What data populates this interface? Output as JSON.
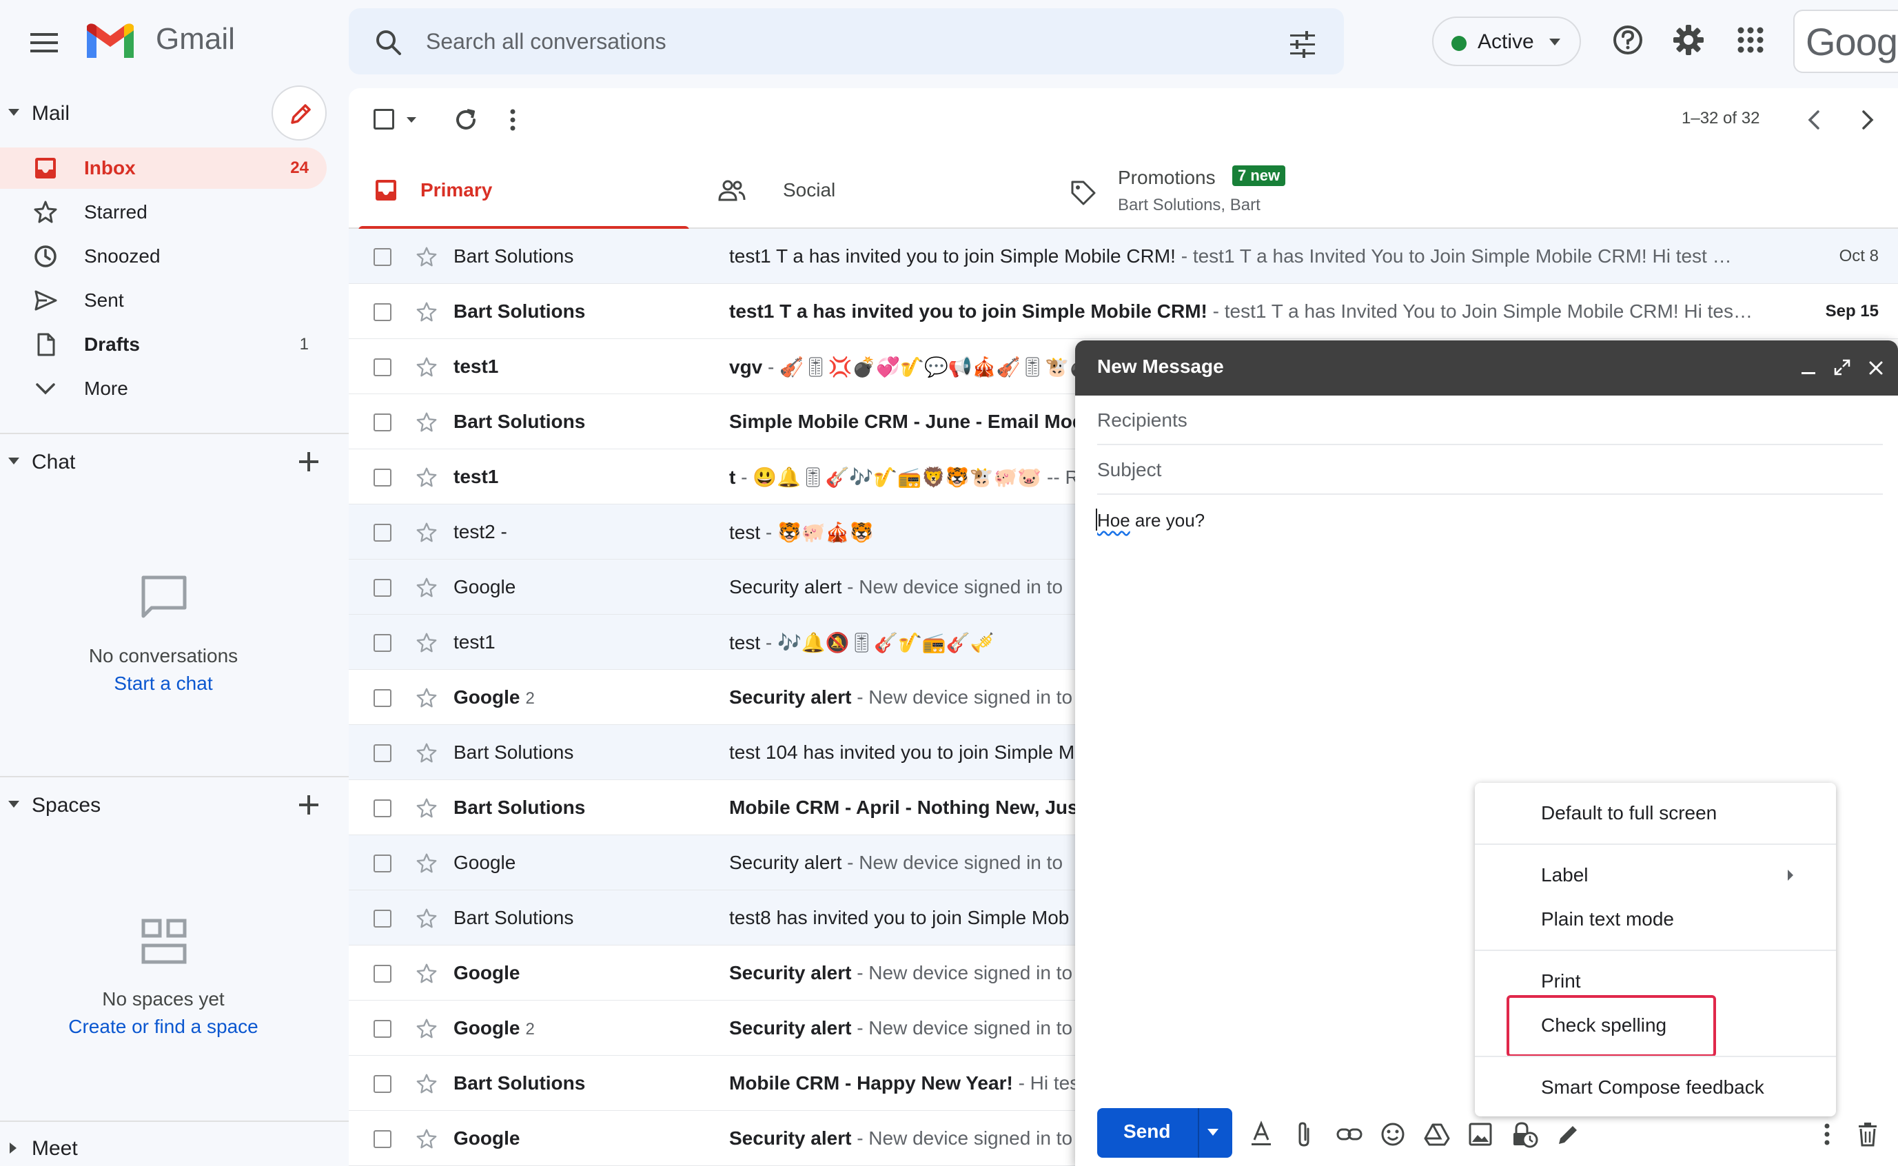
{
  "app": {
    "brand": "Gmail",
    "account_logo_text": "Googl",
    "icons": [
      "menu-icon",
      "gmail-logo-icon",
      "search-icon",
      "tune-icon",
      "help-icon",
      "settings-icon",
      "apps-icon"
    ]
  },
  "search": {
    "placeholder": "Search all conversations"
  },
  "status": {
    "label": "Active",
    "color": "#1e8e3e"
  },
  "sidebar": {
    "mail_title": "Mail",
    "items": [
      {
        "label": "Inbox",
        "count": "24",
        "icon": "inbox-icon",
        "active": true
      },
      {
        "label": "Starred",
        "count": "",
        "icon": "star-icon"
      },
      {
        "label": "Snoozed",
        "count": "",
        "icon": "clock-icon"
      },
      {
        "label": "Sent",
        "count": "",
        "icon": "send-icon"
      },
      {
        "label": "Drafts",
        "count": "1",
        "icon": "draft-icon"
      },
      {
        "label": "More",
        "count": "",
        "icon": "chevron-down-icon"
      }
    ],
    "chat": {
      "title": "Chat",
      "empty": "No conversations",
      "link": "Start a chat"
    },
    "spaces": {
      "title": "Spaces",
      "empty": "No spaces yet",
      "link": "Create or find a space"
    },
    "meet": {
      "title": "Meet"
    }
  },
  "toolbar": {
    "pagination": "1–32 of 32"
  },
  "tabs": {
    "primary": "Primary",
    "social": "Social",
    "promotions": "Promotions",
    "promotions_badge": "7 new",
    "promotions_sub": "Bart Solutions, Bart"
  },
  "emails": [
    {
      "sender": "Bart Solutions",
      "count": "",
      "subject": "test1 T a has invited you to join Simple Mobile CRM!",
      "snippet": " - test1 T a has Invited You to Join Simple Mobile CRM! Hi test …",
      "date": "Oct 8",
      "unread": false
    },
    {
      "sender": "Bart Solutions",
      "count": "",
      "subject": "test1 T a has invited you to join Simple Mobile CRM!",
      "snippet": " - test1 T a has Invited You to Join Simple Mobile CRM! Hi tes…",
      "date": "Sep 15",
      "unread": true
    },
    {
      "sender": "test1",
      "count": "",
      "subject": "vgv",
      "snippet": " - 🎻🎚💢💣💞🎷💬📢🎪🎻🎚🐮💣",
      "date": "",
      "unread": true
    },
    {
      "sender": "Bart Solutions",
      "count": "",
      "subject": "Simple Mobile CRM - June - Email Mod",
      "snippet": "",
      "date": "",
      "unread": true
    },
    {
      "sender": "test1",
      "count": "",
      "subject": "t",
      "snippet": " - 😃🔔🎚🎸🎶🎷📻🦁🐯🐮🐖🐷 -- Re",
      "date": "",
      "unread": true
    },
    {
      "sender": "test2 -",
      "count": "",
      "subject": "test",
      "snippet": " - 🐯🐖🎪🐯",
      "date": "",
      "unread": false
    },
    {
      "sender": "Google",
      "count": "",
      "subject": "Security alert",
      "snippet": " - New device signed in to",
      "date": "",
      "unread": false
    },
    {
      "sender": "test1",
      "count": "",
      "subject": "test",
      "snippet": " - 🎶🔔🔕🎚🎸🎷📻🎸🎺",
      "date": "",
      "unread": false
    },
    {
      "sender": "Google",
      "count": "2",
      "subject": "Security alert",
      "snippet": " - New device signed in to",
      "date": "",
      "unread": true
    },
    {
      "sender": "Bart Solutions",
      "count": "",
      "subject": "test 104 has invited you to join Simple M",
      "snippet": "",
      "date": "",
      "unread": false
    },
    {
      "sender": "Bart Solutions",
      "count": "",
      "subject": "Mobile CRM - April - Nothing New, Just",
      "snippet": "",
      "date": "",
      "unread": true
    },
    {
      "sender": "Google",
      "count": "",
      "subject": "Security alert",
      "snippet": " - New device signed in to",
      "date": "",
      "unread": false
    },
    {
      "sender": "Bart Solutions",
      "count": "",
      "subject": "test8 has invited you to join Simple Mob",
      "snippet": "",
      "date": "",
      "unread": false
    },
    {
      "sender": "Google",
      "count": "",
      "subject": "Security alert",
      "snippet": " - New device signed in to",
      "date": "",
      "unread": true
    },
    {
      "sender": "Google",
      "count": "2",
      "subject": "Security alert",
      "snippet": " - New device signed in to",
      "date": "",
      "unread": true
    },
    {
      "sender": "Bart Solutions",
      "count": "",
      "subject": "Mobile CRM - Happy New Year!",
      "snippet": " - Hi tes",
      "date": "",
      "unread": true
    },
    {
      "sender": "Google",
      "count": "",
      "subject": "Security alert",
      "snippet": " - New device signed in to",
      "date": "",
      "unread": true
    }
  ],
  "compose": {
    "title": "New Message",
    "recipients_placeholder": "Recipients",
    "subject_placeholder": "Subject",
    "body_misspelled": "Hoe",
    "body_rest": " are you?",
    "send_label": "Send"
  },
  "menu": {
    "items": [
      "Default to full screen",
      "Label",
      "Plain text mode",
      "Print",
      "Check spelling",
      "Smart Compose feedback"
    ],
    "highlight_color": "#e0284b"
  }
}
